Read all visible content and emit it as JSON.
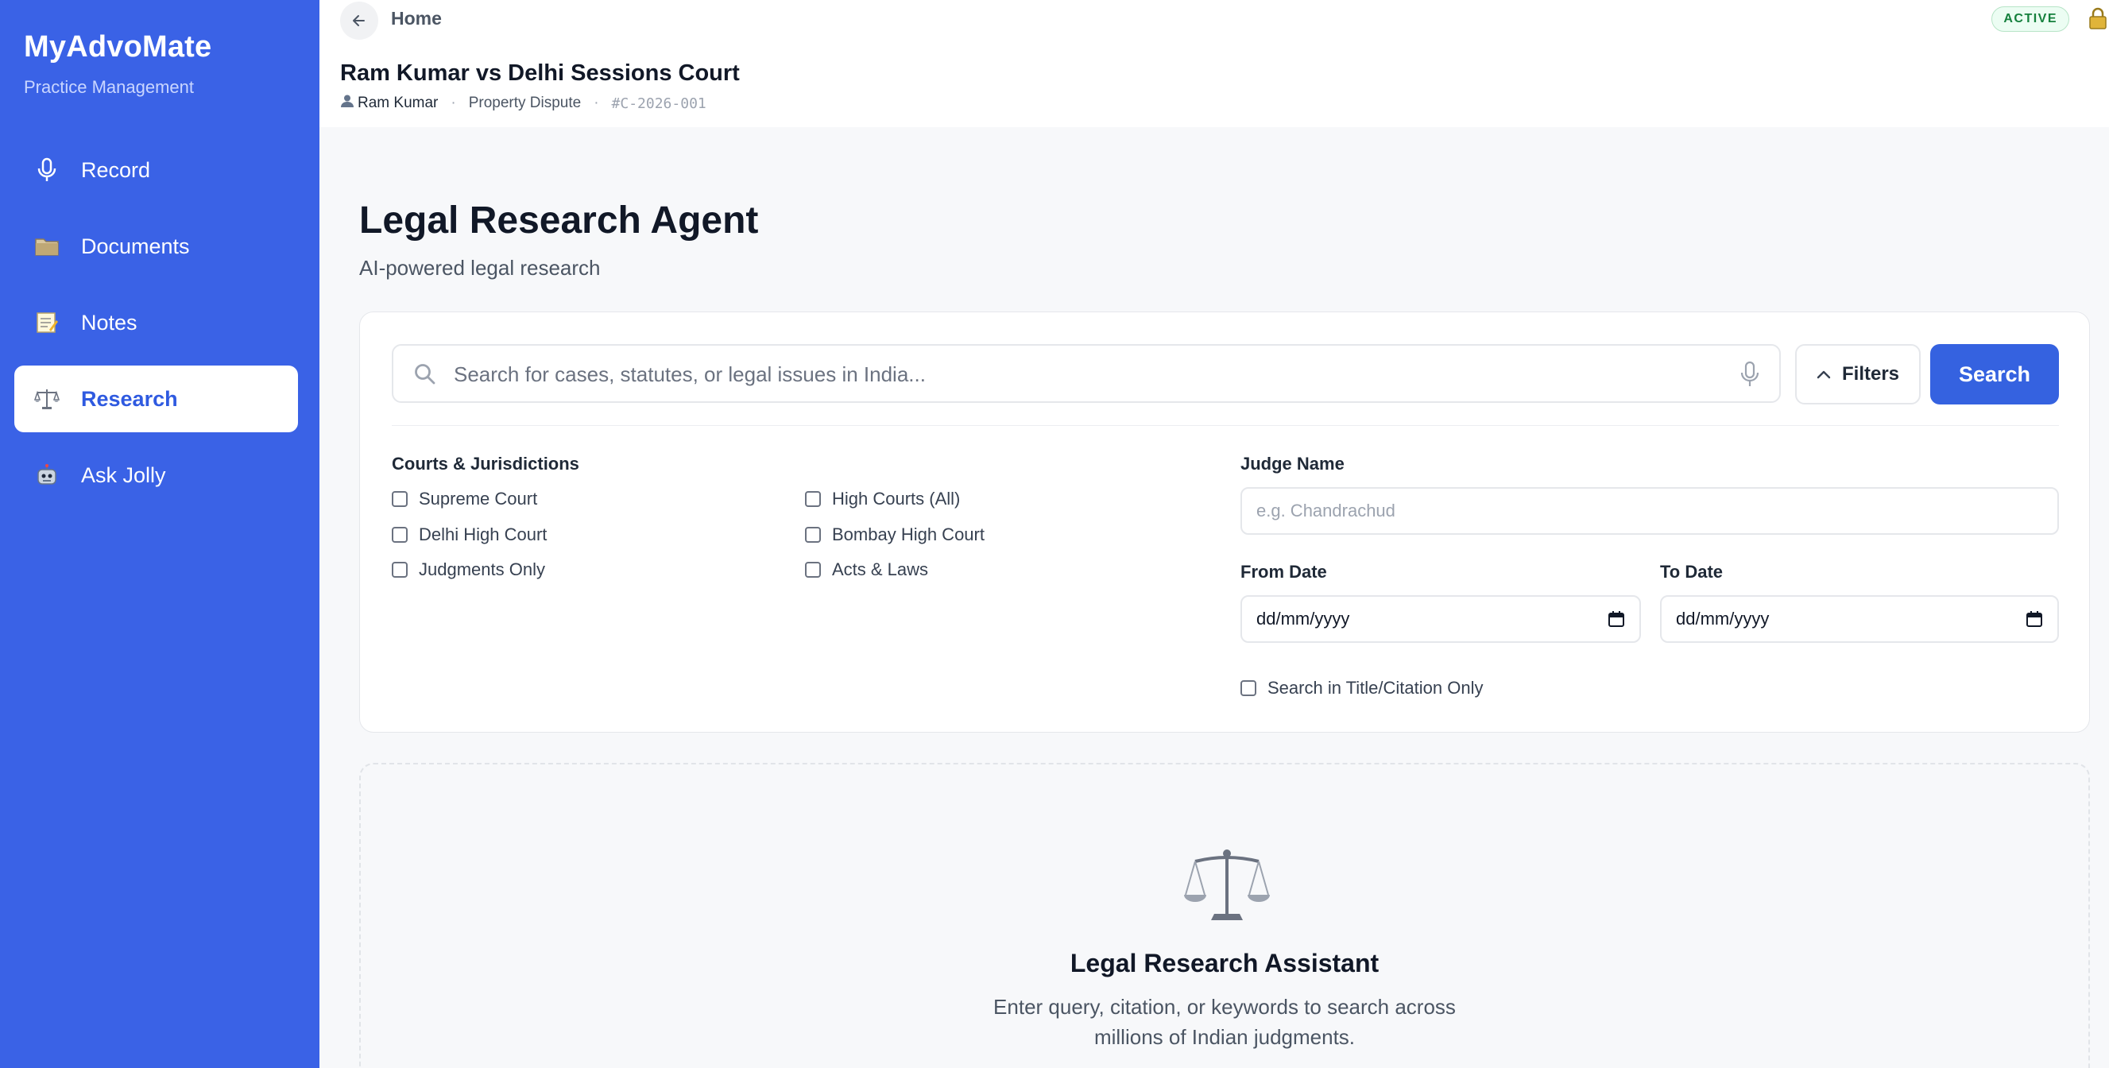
{
  "sidebar": {
    "brand": "MyAdvoMate",
    "subtitle": "Practice Management",
    "items": [
      {
        "label": "Record",
        "icon": "microphone-icon",
        "active": false
      },
      {
        "label": "Documents",
        "icon": "folder-icon",
        "active": false
      },
      {
        "label": "Notes",
        "icon": "memo-icon",
        "active": false
      },
      {
        "label": "Research",
        "icon": "scales-icon",
        "active": true
      },
      {
        "label": "Ask Jolly",
        "icon": "robot-icon",
        "active": false
      }
    ]
  },
  "header": {
    "breadcrumb": "Home",
    "case_title": "Ram Kumar vs Delhi Sessions Court",
    "client": "Ram Kumar",
    "case_type": "Property Dispute",
    "case_number": "#C-2026-001",
    "status": "ACTIVE"
  },
  "main": {
    "title": "Legal Research Agent",
    "subtitle": "AI-powered legal research",
    "search": {
      "placeholder": "Search for cases, statutes, or legal issues in India...",
      "value": "",
      "filters_label": "Filters",
      "search_label": "Search"
    },
    "courts": {
      "label": "Courts & Jurisdictions",
      "options": [
        "Supreme Court",
        "High Courts (All)",
        "Delhi High Court",
        "Bombay High Court",
        "Judgments Only",
        "Acts & Laws"
      ]
    },
    "judge": {
      "label": "Judge Name",
      "placeholder": "e.g. Chandrachud"
    },
    "from_date": {
      "label": "From Date",
      "value": "dd/mm/yyyy"
    },
    "to_date": {
      "label": "To Date",
      "value": "dd/mm/yyyy"
    },
    "title_only_label": "Search in Title/Citation Only",
    "empty_state": {
      "title": "Legal Research Assistant",
      "desc_line1": "Enter query, citation, or keywords to search across",
      "desc_line2": "millions of Indian judgments."
    }
  },
  "colors": {
    "sidebar_bg": "#3a62e6",
    "primary": "#3562e0",
    "active_badge": "#15803d"
  }
}
